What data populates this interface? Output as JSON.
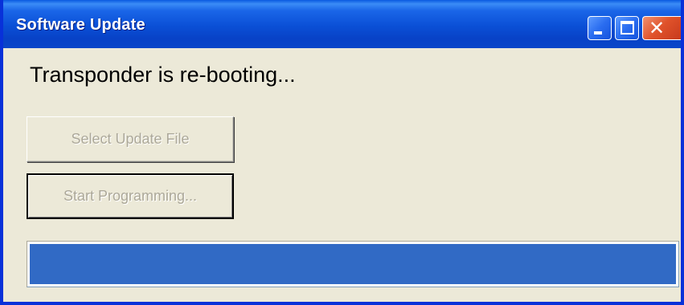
{
  "window": {
    "title": "Software Update",
    "close_glyph": "✕"
  },
  "status": {
    "message": "Transponder is re-booting..."
  },
  "buttons": {
    "select_update_file": "Select Update File",
    "start_programming": "Start Programming..."
  },
  "progress": {
    "value_percent": 100,
    "color": "#316ac5"
  },
  "theme": {
    "titlebar_blue": "#0a4fd6",
    "window_bg": "#ece9d8",
    "close_red": "#e0522a"
  }
}
